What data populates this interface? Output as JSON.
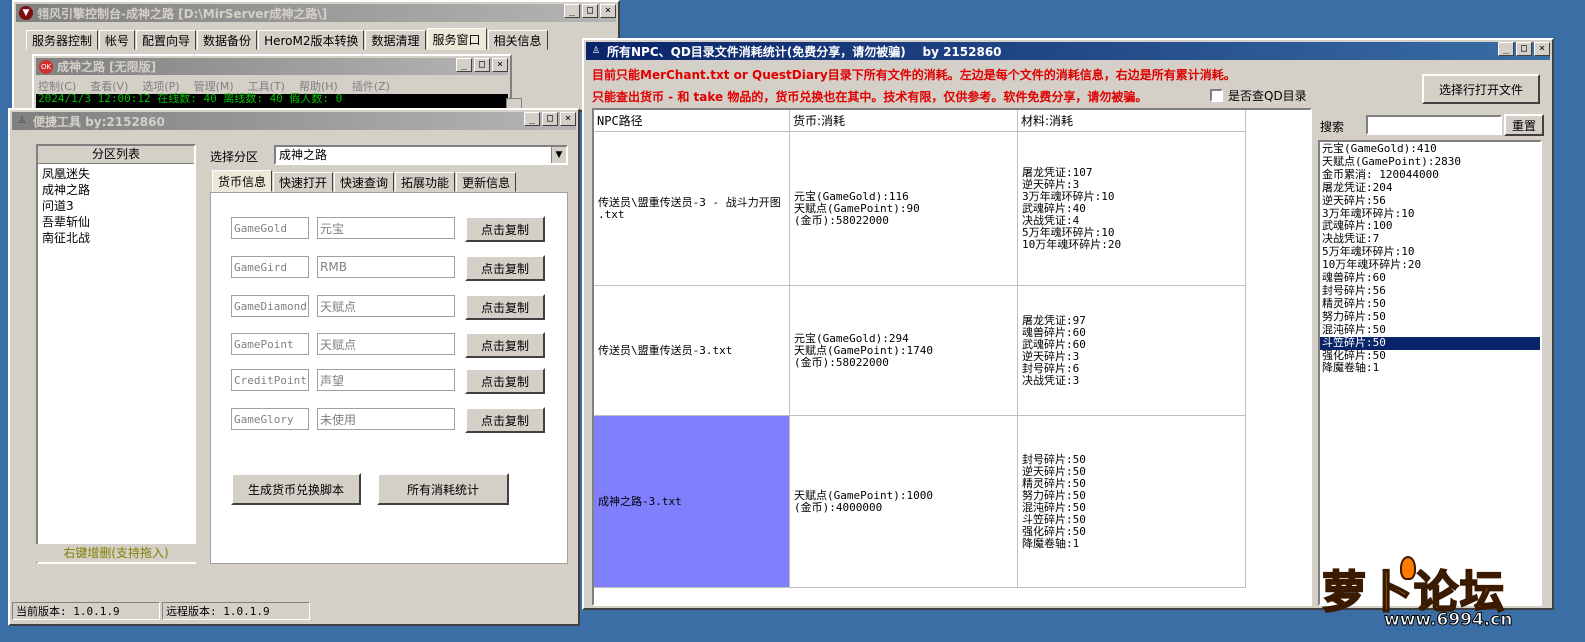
{
  "back_window": {
    "title": "翎风引擎控制台-成神之路 [D:\\MirServer成神之路\\]",
    "tabs": [
      "服务器控制",
      "帐号",
      "配置向导",
      "数据备份",
      "HeroM2版本转换",
      "数据清理",
      "服务窗口",
      "相关信息"
    ],
    "selected_tab": "服务窗口",
    "inner": {
      "title": "成神之路 [无限版]",
      "menu": [
        "控制(C)",
        "查看(V)",
        "选项(P)",
        "管理(M)",
        "工具(T)",
        "帮助(H)",
        "插件(Z)"
      ],
      "status": "2024/1/3 12:00:12 在线数: 40 离线数: 40 假人数: 0"
    }
  },
  "tool_window": {
    "title": "便捷工具  by:2152860",
    "zone_list_header": "分区列表",
    "zones": [
      "凤凰迷失",
      "成神之路",
      "问道3",
      "吾辈斩仙",
      "南征北战"
    ],
    "zone_hint": "右键增删(支持拖入)",
    "select_label": "选择分区",
    "selected_zone": "成神之路",
    "tabs": [
      "货币信息",
      "快速打开",
      "快速查询",
      "拓展功能",
      "更新信息"
    ],
    "currency_rows": [
      {
        "key": "GameGold",
        "name": "元宝",
        "button": "点击复制"
      },
      {
        "key": "GameGird",
        "name": "RMB",
        "button": "点击复制"
      },
      {
        "key": "GameDiamond",
        "name": "天赋点",
        "button": "点击复制"
      },
      {
        "key": "GamePoint",
        "name": "天赋点",
        "button": "点击复制"
      },
      {
        "key": "CreditPoint",
        "name": "声望",
        "button": "点击复制"
      },
      {
        "key": "GameGlory",
        "name": "未使用",
        "button": "点击复制"
      }
    ],
    "generate_button": "生成货币兑换脚本",
    "stats_button": "所有消耗统计",
    "current_version": "当前版本: 1.0.1.9",
    "remote_version": "远程版本: 1.0.1.9"
  },
  "stats_window": {
    "title": "所有NPC、QD目录文件消耗统计(免费分享，请勿被骗)    by 2152860",
    "notice1": "目前只能MerChant.txt or QuestDiary目录下所有文件的消耗。左边是每个文件的消耗信息，右边是所有累计消耗。",
    "notice2": "只能查出货币 - 和 take 物品的，货币兑换也在其中。技术有限，仅供参考。软件免费分享，请勿被骗。",
    "qd_checkbox_label": "是否查QD目录",
    "open_button": "选择行打开文件",
    "search_label": "搜索",
    "search_value": "",
    "reset_button": "重置",
    "columns": [
      "NPC路径",
      "货币:消耗",
      "材料:消耗"
    ],
    "rows": [
      {
        "path": "传送员\\盟重传送员-3 - 战斗力开图\n.txt",
        "currency": "元宝(GameGold):116\n天赋点(GamePoint):90\n(金币):58022000",
        "materials": "屠龙凭证:107\n逆天碎片:3\n3万年魂环碎片:10\n武魂碎片:40\n决战凭证:4\n5万年魂环碎片:10\n10万年魂环碎片:20"
      },
      {
        "path": "传送员\\盟重传送员-3.txt",
        "currency": "元宝(GameGold):294\n天赋点(GamePoint):1740\n(金币):58022000",
        "materials": "屠龙凭证:97\n魂兽碎片:60\n武魂碎片:60\n逆天碎片:3\n封号碎片:6\n决战凭证:3"
      },
      {
        "path": "成神之路-3.txt",
        "currency": "天赋点(GamePoint):1000\n(金币):4000000",
        "materials": "封号碎片:50\n逆天碎片:50\n精灵碎片:50\n努力碎片:50\n混沌碎片:50\n斗笠碎片:50\n强化碎片:50\n降魔卷轴:1"
      }
    ],
    "totals": [
      "元宝(GameGold):410",
      "天赋点(GamePoint):2830",
      "金币累消: 120044000",
      "屠龙凭证:204",
      "逆天碎片:56",
      "3万年魂环碎片:10",
      "武魂碎片:100",
      "决战凭证:7",
      "5万年魂环碎片:10",
      "10万年魂环碎片:20",
      "魂兽碎片:60",
      "封号碎片:56",
      "精灵碎片:50",
      "努力碎片:50",
      "混沌碎片:50",
      "斗笠碎片:50",
      "强化碎片:50",
      "降魔卷轴:1"
    ],
    "selected_total": "斗笠碎片:50"
  },
  "watermark": {
    "logo_text": "萝卜论坛",
    "url": "www.6994.cn"
  },
  "colors": {
    "active_title": "#0a246a",
    "notice_red": "#e00000",
    "selected_row": "#8080ff",
    "list_selection": "#0a246a"
  }
}
